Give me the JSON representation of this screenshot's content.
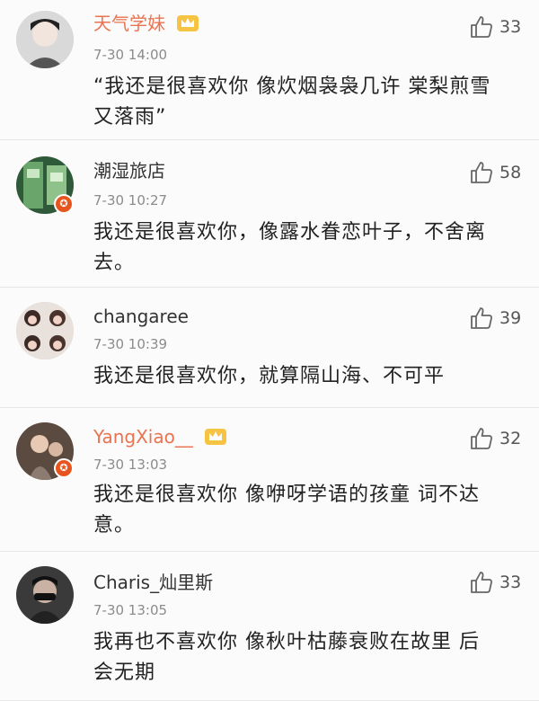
{
  "comments": [
    {
      "username": "天气学妹",
      "time": "7-30 14:00",
      "text_line1": "“我还是很喜欢你 像炊烟袅袅几许 棠梨煎雪",
      "text_line2": "又落雨”",
      "likes": "33",
      "vip": true,
      "verified": false
    },
    {
      "username": "潮湿旅店",
      "time": "7-30 10:27",
      "text_line1": "我还是很喜欢你，像露水眷恋叶子，不舍离",
      "text_line2": "去。",
      "likes": "58",
      "vip": false,
      "verified": true
    },
    {
      "username": "changaree",
      "time": "7-30 10:39",
      "text_line1": "我还是很喜欢你，就算隔山海、不可平",
      "text_line2": "",
      "likes": "39",
      "vip": false,
      "verified": false
    },
    {
      "username": "YangXiao__",
      "time": "7-30 13:03",
      "text_line1": "我还是很喜欢你 像咿呀学语的孩童 词不达",
      "text_line2": "意。",
      "likes": "32",
      "vip": true,
      "verified": true
    },
    {
      "username": "Charis_灿里斯",
      "time": "7-30 13:05",
      "text_line1": "我再也不喜欢你 像秋叶枯藤衰败在故里 后",
      "text_line2": "会无期",
      "likes": "33",
      "vip": false,
      "verified": false
    }
  ],
  "colors": {
    "vip_name": "#eb7350",
    "badge": "#e8541e",
    "separator": "#e6e6e6"
  },
  "icons": {
    "like": "thumbs-up-icon",
    "crown": "crown-icon",
    "verified": "verified-badge-icon"
  }
}
